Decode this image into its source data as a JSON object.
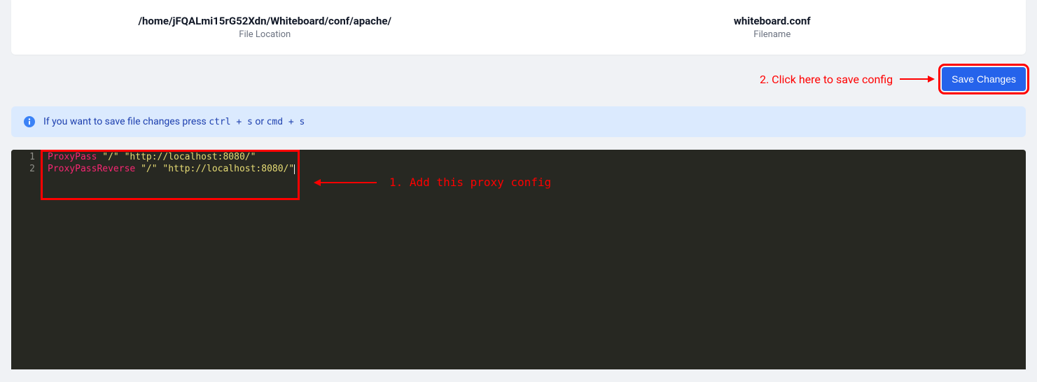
{
  "header": {
    "file_location": {
      "path": "/home/jFQALmi15rG52Xdn/Whiteboard/conf/apache/",
      "label": "File Location"
    },
    "filename": {
      "name": "whiteboard.conf",
      "label": "Filename"
    }
  },
  "toolbar": {
    "save_label": "Save Changes"
  },
  "annotations": {
    "save_note": "2. Click here to save config",
    "editor_note": "1. Add this proxy config"
  },
  "info_banner": {
    "prefix": "If you want to save file changes press ",
    "shortcut1": "ctrl + s",
    "middle": " or ",
    "shortcut2": "cmd + s"
  },
  "editor": {
    "gutter": [
      "1",
      "2"
    ],
    "lines": [
      {
        "directive": "ProxyPass",
        "a1": "\"/\"",
        "a2": "\"http://localhost:8080/\""
      },
      {
        "directive": "ProxyPassReverse",
        "a1": "\"/\"",
        "a2": "\"http://localhost:8080/\""
      }
    ]
  }
}
